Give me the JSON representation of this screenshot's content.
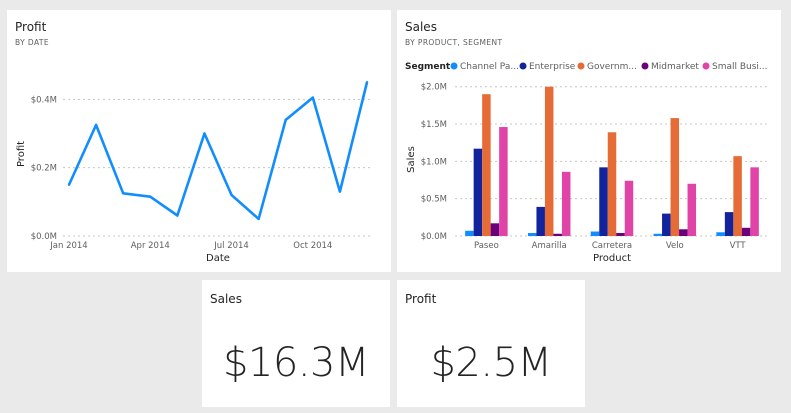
{
  "cards": {
    "profit_line": {
      "title": "Profit",
      "subtitle": "BY DATE"
    },
    "sales_bar": {
      "title": "Sales",
      "subtitle": "BY PRODUCT, SEGMENT"
    },
    "sales_kpi": {
      "title": "Sales",
      "value": "$16.3M"
    },
    "profit_kpi": {
      "title": "Profit",
      "value": "$2.5M"
    }
  },
  "colors": {
    "line": "#118dff",
    "channel_partners": "#118dff",
    "enterprise": "#12239e",
    "government": "#e66c37",
    "midmarket": "#6b007b",
    "small_business": "#e044a7"
  },
  "chart_data": [
    {
      "type": "line",
      "title": "Profit",
      "subtitle": "BY DATE",
      "xlabel": "Date",
      "ylabel": "Profit",
      "x": [
        "2014-01",
        "2014-02",
        "2014-03",
        "2014-04",
        "2014-05",
        "2014-06",
        "2014-07",
        "2014-08",
        "2014-09",
        "2014-10",
        "2014-11",
        "2014-12"
      ],
      "x_tick_labels": [
        "Jan 2014",
        "Apr 2014",
        "Jul 2014",
        "Oct 2014"
      ],
      "x_tick_months": [
        "2014-01",
        "2014-04",
        "2014-07",
        "2014-10"
      ],
      "y_tick_labels": [
        "$0.0M",
        "$0.2M",
        "$0.4M"
      ],
      "y_tick_values": [
        0,
        0.2,
        0.4
      ],
      "values": [
        0.15,
        0.325,
        0.125,
        0.115,
        0.06,
        0.3,
        0.12,
        0.05,
        0.34,
        0.405,
        0.13,
        0.45
      ],
      "ylim": [
        0,
        0.48
      ],
      "grid": true
    },
    {
      "type": "bar",
      "title": "Sales",
      "subtitle": "BY PRODUCT, SEGMENT",
      "xlabel": "Product",
      "ylabel": "Sales",
      "legend_title": "Segment",
      "legend_position": "top",
      "categories": [
        "Paseo",
        "Amarilla",
        "Carretera",
        "Velo",
        "VTT"
      ],
      "y_tick_labels": [
        "$0.0M",
        "$0.5M",
        "$1.0M",
        "$1.5M",
        "$2.0M"
      ],
      "y_tick_values": [
        0,
        0.5,
        1.0,
        1.5,
        2.0
      ],
      "ylim": [
        0,
        2.05
      ],
      "grid": true,
      "series": [
        {
          "name": "Channel Pa...",
          "values": [
            0.07,
            0.04,
            0.06,
            0.03,
            0.05
          ]
        },
        {
          "name": "Enterprise",
          "values": [
            1.17,
            0.39,
            0.92,
            0.3,
            0.32
          ]
        },
        {
          "name": "Governm...",
          "values": [
            1.9,
            2.0,
            1.39,
            1.58,
            1.07
          ]
        },
        {
          "name": "Midmarket",
          "values": [
            0.17,
            0.03,
            0.04,
            0.09,
            0.11
          ]
        },
        {
          "name": "Small Busi...",
          "values": [
            1.46,
            0.86,
            0.74,
            0.7,
            0.92
          ]
        }
      ]
    }
  ]
}
